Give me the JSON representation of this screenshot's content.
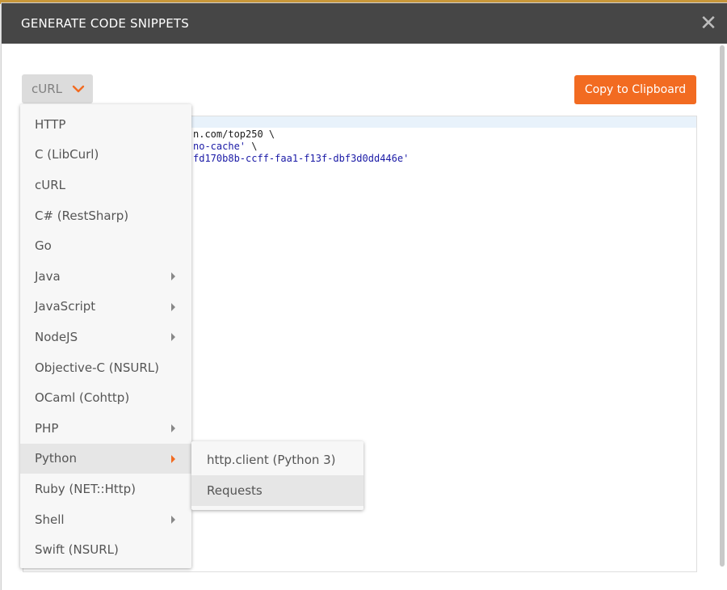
{
  "modal": {
    "title": "GENERATE CODE SNIPPETS",
    "close_symbol": "✕"
  },
  "language_select": {
    "selected": "cURL",
    "chevron_icon": "chevron-down-icon",
    "chevron_color": "#f26b21"
  },
  "toolbar": {
    "copy_label": "Copy to Clipboard"
  },
  "code": {
    "lines": [
      {
        "plain": "n.com/top250 \\",
        "string": ""
      },
      {
        "plain": "",
        "string": "no-cache'",
        "tail": " \\"
      },
      {
        "plain": "",
        "string": "fd170b8b-ccff-faa1-f13f-dbf3d0dd446e'",
        "tail": ""
      }
    ]
  },
  "language_menu": {
    "items": [
      {
        "label": "HTTP",
        "has_submenu": false
      },
      {
        "label": "C (LibCurl)",
        "has_submenu": false
      },
      {
        "label": "cURL",
        "has_submenu": false
      },
      {
        "label": "C# (RestSharp)",
        "has_submenu": false
      },
      {
        "label": "Go",
        "has_submenu": false
      },
      {
        "label": "Java",
        "has_submenu": true
      },
      {
        "label": "JavaScript",
        "has_submenu": true
      },
      {
        "label": "NodeJS",
        "has_submenu": true
      },
      {
        "label": "Objective-C (NSURL)",
        "has_submenu": false
      },
      {
        "label": "OCaml (Cohttp)",
        "has_submenu": false
      },
      {
        "label": "PHP",
        "has_submenu": true
      },
      {
        "label": "Python",
        "has_submenu": true,
        "active": true
      },
      {
        "label": "Ruby (NET::Http)",
        "has_submenu": false
      },
      {
        "label": "Shell",
        "has_submenu": true
      },
      {
        "label": "Swift (NSURL)",
        "has_submenu": false
      }
    ]
  },
  "python_submenu": {
    "items": [
      {
        "label": "http.client (Python 3)"
      },
      {
        "label": "Requests",
        "hover": true
      }
    ]
  },
  "colors": {
    "header_bg": "#464646",
    "accent": "#f26b21",
    "code_string": "#1a1aa6"
  }
}
